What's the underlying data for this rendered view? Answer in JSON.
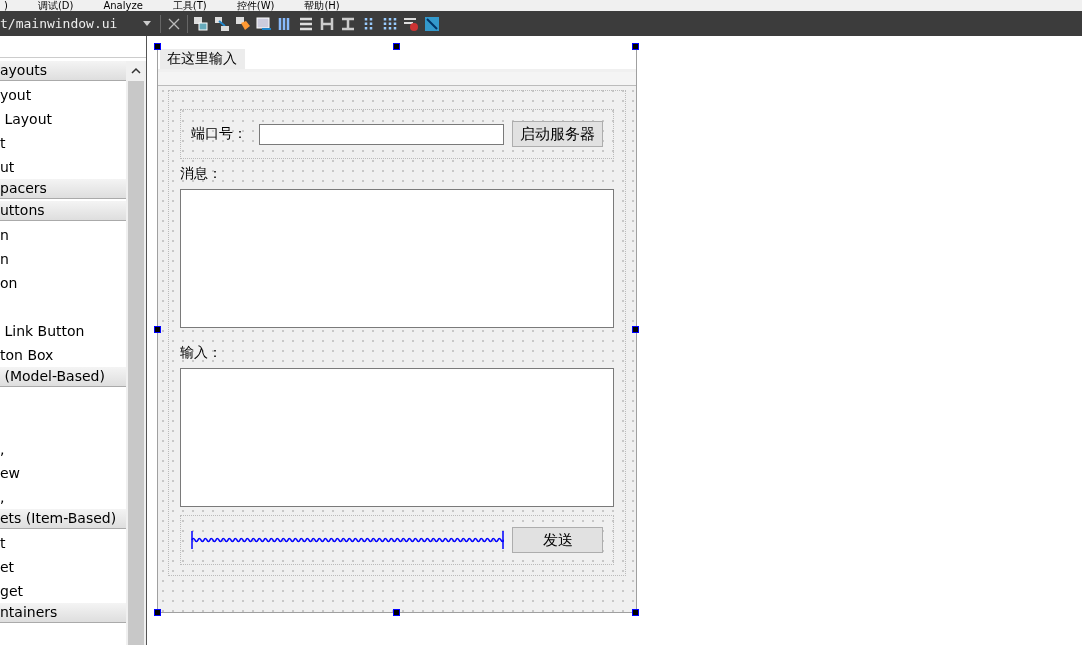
{
  "menu_bar": {
    "items": [
      ")",
      "调试(D)",
      "Analyze",
      "工具(T)",
      "控件(W)",
      "帮助(H)"
    ]
  },
  "toolbar": {
    "file_combo": "t/mainwindow.ui"
  },
  "widget_box": {
    "groups": [
      {
        "title": "ayouts",
        "items": [
          {
            "kind": "text",
            "label": "yout"
          },
          {
            "kind": "text",
            "label": " Layout"
          },
          {
            "kind": "text",
            "label": "t"
          },
          {
            "kind": "text",
            "label": "ut"
          }
        ]
      },
      {
        "title": "pacers"
      },
      {
        "title": "uttons",
        "items": [
          {
            "kind": "text",
            "label": "n"
          },
          {
            "kind": "text",
            "label": "n"
          },
          {
            "kind": "text",
            "label": "on"
          },
          {
            "kind": "blank"
          },
          {
            "kind": "text",
            "label": " Link Button"
          },
          {
            "kind": "text",
            "label": "ton Box"
          }
        ]
      },
      {
        "title": " (Model-Based)",
        "items": [
          {
            "kind": "blank"
          },
          {
            "kind": "blank"
          },
          {
            "kind": "text",
            "label": ","
          },
          {
            "kind": "text",
            "label": "ew"
          },
          {
            "kind": "text",
            "label": ","
          }
        ]
      },
      {
        "title": "ets (Item-Based)",
        "items": [
          {
            "kind": "text",
            "label": "t"
          },
          {
            "kind": "text",
            "label": "et"
          },
          {
            "kind": "text",
            "label": "get"
          }
        ]
      },
      {
        "title": "ntainers"
      }
    ]
  },
  "form": {
    "menu_placeholder": "在这里输入",
    "port_label": "端口号：",
    "start_button": "启动服务器",
    "message_label": "消息：",
    "input_label": "输入：",
    "send_button": "发送"
  }
}
